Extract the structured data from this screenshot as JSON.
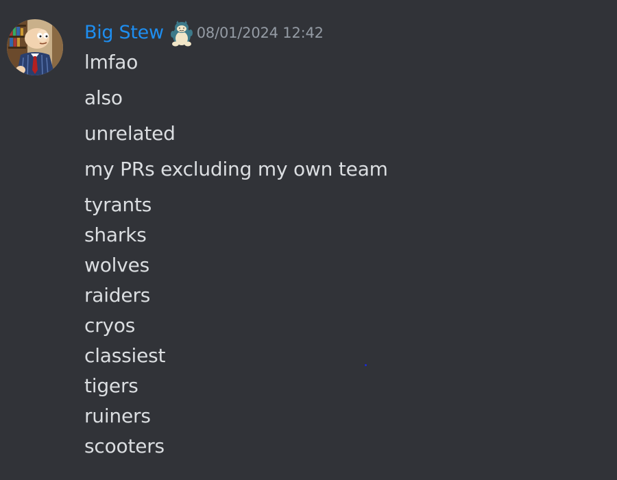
{
  "author": {
    "name": "Big Stew",
    "name_color": "#1e8ef0",
    "avatar_icon": "cartoon-avatar-icon",
    "badge_icon": "snorlax-badge-icon"
  },
  "timestamp": "08/01/2024 12:42",
  "messages": [
    "lmfao",
    "also",
    "unrelated",
    "my PRs excluding my own team",
    "tyrants",
    "sharks",
    "wolves",
    "raiders",
    "cryos",
    "classiest",
    "tigers",
    "ruiners",
    "scooters"
  ],
  "colors": {
    "background": "#313338",
    "text": "#dbdee1",
    "timestamp": "#949ba4"
  }
}
